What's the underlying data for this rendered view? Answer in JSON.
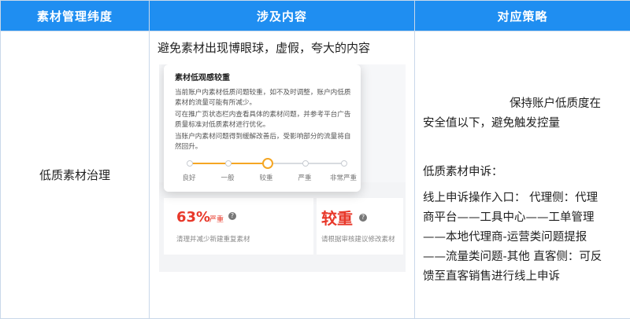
{
  "table": {
    "headers": [
      "素材管理纬度",
      "涉及内容",
      "对应策略"
    ],
    "dimension": "低质素材治理",
    "content_headline": "避免素材出现博眼球，虚假，夸大的内容",
    "strategy": {
      "line1": "保持账户低质度在",
      "line2": "安全值以下，避免触发控量",
      "appeal_title": "低质素材申诉：",
      "appeal_lines": [
        "线上申诉操作入口： 代理侧：代理",
        "商平台——工具中心——工单管理",
        "——本地代理商-运营类问题提报",
        "——流量类问题-其他 直客侧：可反",
        "馈至直客销售进行线上申诉"
      ]
    }
  },
  "screenshot": {
    "popup_title": "素材低观感较重",
    "paragraphs": [
      "当前账户内素材低质问题较重，如不及时调整，账户内低质素材的流量可能有所减少。",
      "可在推广页状态栏内查看具体的素材问题，并参考平台广告质量标准对低质素材进行优化。",
      "当账户内素材问题得到缓解改善后，受影响部分的流量将自然回升。"
    ],
    "scale_labels": [
      "良好",
      "一般",
      "较重",
      "严重",
      "非常严重"
    ],
    "scale_active_index": 2,
    "percent": "63%",
    "percent_tag": "严重",
    "percent_sub": "清理并减少新建重复素材",
    "level": "较重",
    "level_sub": "请根据审核建议修改素材",
    "colors": {
      "accent": "#f5a623",
      "alert": "#e8382a",
      "header": "#1f8ef1"
    }
  }
}
